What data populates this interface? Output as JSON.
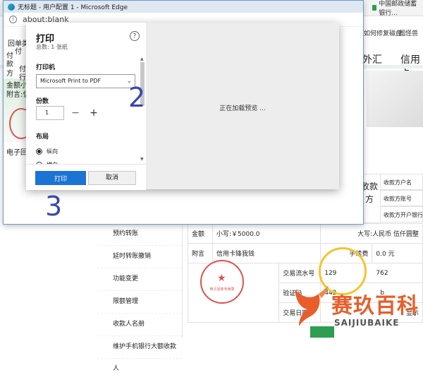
{
  "browser": {
    "window_title": "无标题 - 用户配置 1 - Microsoft Edge",
    "url": "about:blank"
  },
  "background_page": {
    "tab_right": "中国邮政储蓄银行...",
    "bookmarks": [
      "如何修复磁盘...",
      "图怪兽"
    ],
    "nav_items": [
      "外汇",
      "信用卡"
    ],
    "left_fragments": [
      "回单类",
      "付",
      "付",
      "付",
      "款",
      "方",
      "行",
      "金额小",
      "附言:信",
      "电子回"
    ],
    "right_fragment": "称",
    "payee_label": "收款方",
    "payee_rows": [
      "收款方户名",
      "收款方账号",
      "收款方开户银行"
    ],
    "side_menu": [
      "预约转账",
      "延时转账撤销",
      "功能变更",
      "限额管理",
      "收款人名册",
      "维护手机银行大额收款人"
    ],
    "table": {
      "amount_label": "金额",
      "amount_lower": "小写:￥5000.0",
      "amount_upper": "大写:人民币 伍仟圆整",
      "memo_label": "附言",
      "memo_value": "信用卡锋我钱",
      "fee_label": "手续费",
      "fee_value": "0.0 元",
      "serial_label": "交易流水号",
      "serial_value": "129",
      "serial_value_tail": "762",
      "verify_label": "验证码",
      "verify_value": "442",
      "verify_value_tail": "b",
      "date_label": "交易日期",
      "side_text": "显示"
    },
    "stamp_text": "电子回单专用章",
    "watermark": {
      "cn": "赛玖百科",
      "en": "SAIJIUBAIKE"
    }
  },
  "print_dialog": {
    "title": "打印",
    "subtitle": "总数: 1 张纸",
    "printer_label": "打印机",
    "printer_value": "Microsoft Print to PDF",
    "copies_label": "份数",
    "copies_value": "1",
    "layout_label": "布局",
    "layout_options": [
      "纵向",
      "横向"
    ],
    "layout_selected": "纵向",
    "preview_text": "正在加载预览 ...",
    "print_button": "打印",
    "cancel_button": "取消"
  },
  "annotations": {
    "step2": "2",
    "step3": "3"
  },
  "colors": {
    "accent": "#1b74d3",
    "step_number": "#3848b0",
    "stamp_red": "#d9534f",
    "watermark_orange": "#e85d2a"
  },
  "icons": [
    "edge-logo-icon",
    "info-icon",
    "help-icon",
    "chevron-down-icon",
    "minus-icon",
    "plus-icon",
    "watermark-logo-icon"
  ]
}
